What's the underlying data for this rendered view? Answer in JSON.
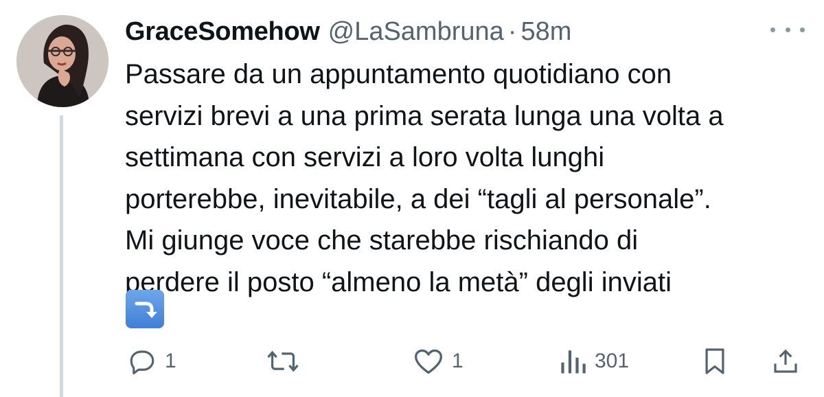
{
  "tweet": {
    "author": {
      "display_name": "GraceSomehow",
      "handle": "@LaSambruna"
    },
    "separator": "·",
    "time": "58m",
    "lines": [
      "Passare da un appuntamento quotidiano con",
      "servizi brevi a una prima serata lunga una volta a",
      "settimana con servizi a loro volta lunghi",
      "porterebbe, inevitabile, a dei “tagli al personale”.",
      "Mi giunge voce che starebbe rischiando di",
      "perdere il posto “almeno la metà” degli inviati"
    ],
    "emoji": "arrow-curving-down-icon"
  },
  "actions": {
    "reply_count": "1",
    "retweet_count": "",
    "like_count": "1",
    "views_count": "301"
  },
  "colors": {
    "text": "#0f1419",
    "secondary": "#536471",
    "thread_line": "#cfd9de",
    "emoji_blue": "#4a8ce0"
  }
}
